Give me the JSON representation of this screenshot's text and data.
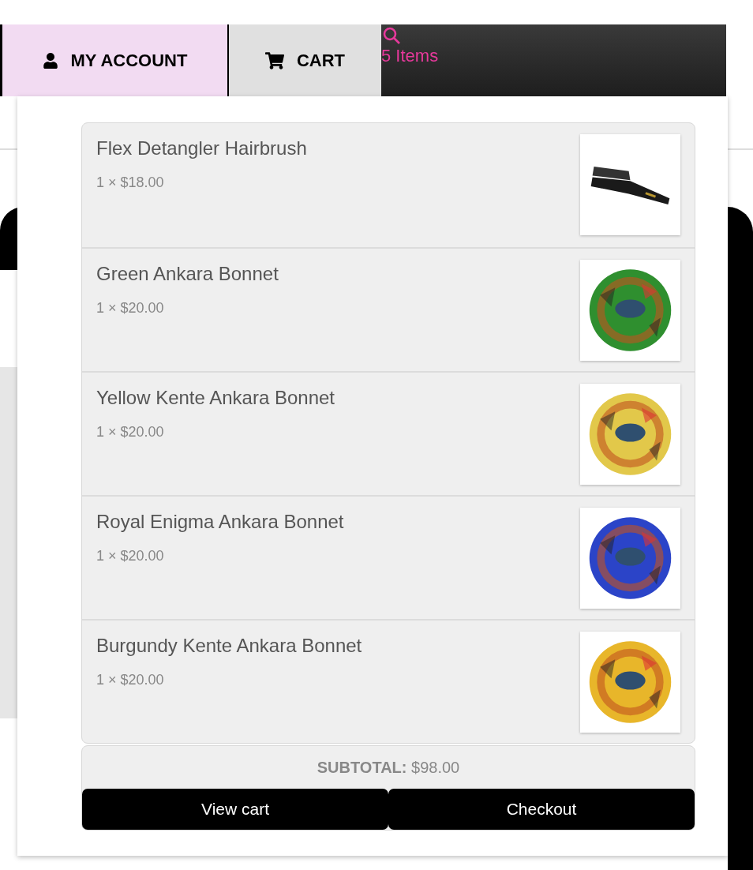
{
  "nav": {
    "items": [
      {
        "kind": "account",
        "label": "MY ACCOUNT",
        "selected": true
      },
      {
        "kind": "cart",
        "label": "CART",
        "selected": false
      }
    ],
    "cart_count": "5 Items"
  },
  "mini_cart": {
    "items": [
      {
        "name": "Flex Detangler Hairbrush",
        "quantity_price": "1 × $18.00",
        "kind": "brush"
      },
      {
        "name": "Green Ankara Bonnet",
        "quantity_price": "1 × $20.00",
        "kind": "bonnet",
        "color": "#2f8f2f"
      },
      {
        "name": "Yellow Kente Ankara Bonnet",
        "quantity_price": "1 × $20.00",
        "kind": "bonnet",
        "color": "#e2c84a"
      },
      {
        "name": "Royal Enigma Ankara Bonnet",
        "quantity_price": "1 × $20.00",
        "kind": "bonnet",
        "color": "#2b44c8"
      },
      {
        "name": "Burgundy Kente Ankara Bonnet",
        "quantity_price": "1 × $20.00",
        "kind": "bonnet",
        "color": "#e8b62a"
      }
    ],
    "subtotal": "**SUBTOTAL:** $98.00",
    "buttons": [
      "View cart",
      "Checkout"
    ]
  }
}
